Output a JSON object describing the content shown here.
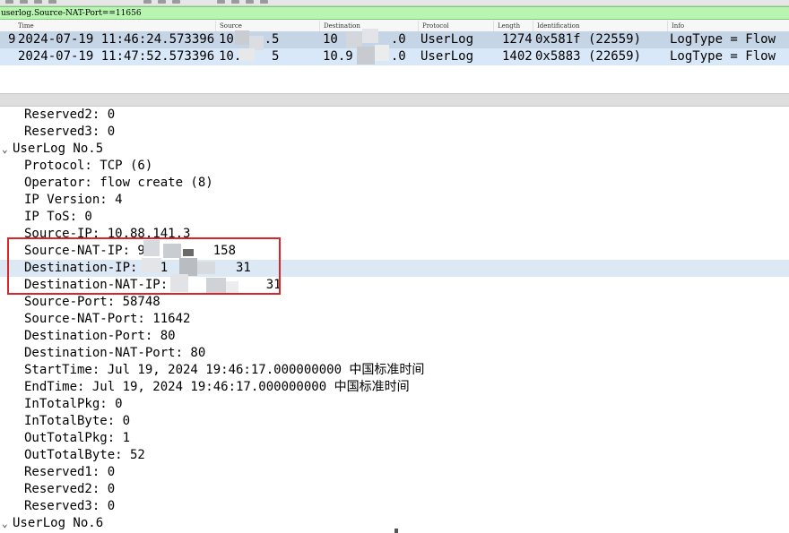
{
  "filter": {
    "value": "userlog.Source-NAT-Port==11656"
  },
  "packet_list": {
    "columns": [
      "Time",
      "Source",
      "Destination",
      "Protocol",
      "Length",
      "Identification",
      "Info"
    ],
    "rows": [
      {
        "no": "9",
        "time": "2024-07-19 11:46:24.573396",
        "source": "10.   .5",
        "destination": "10       .0",
        "protocol": "UserLog",
        "length": "1274",
        "identification": "0x581f (22559)",
        "info": "LogType = Flow"
      },
      {
        "no": "",
        "time": "2024-07-19 11:47:52.573396",
        "source": "10.    5",
        "destination": "10.9     .0",
        "protocol": "UserLog",
        "length": "1402",
        "identification": "0x5883 (22659)",
        "info": "LogType = Flow"
      }
    ]
  },
  "details": {
    "lines": [
      {
        "text": "Reserved2: 0"
      },
      {
        "text": "Reserved3: 0"
      },
      {
        "text": "UserLog No.5"
      },
      {
        "text": "Protocol: TCP (6)"
      },
      {
        "text": "Operator: flow create (8)"
      },
      {
        "text": "IP Version: 4"
      },
      {
        "text": "IP ToS: 0"
      },
      {
        "text": "Source-IP: 10.88.141.3"
      },
      {
        "text": "Source-NAT-IP: 9         158"
      },
      {
        "text": "Destination-IP: 9.1         31"
      },
      {
        "text": "Destination-NAT-IP: 9.          31"
      },
      {
        "text": "Source-Port: 58748"
      },
      {
        "text": "Source-NAT-Port: 11642"
      },
      {
        "text": "Destination-Port: 80"
      },
      {
        "text": "Destination-NAT-Port: 80"
      },
      {
        "text": "StartTime: Jul 19, 2024 19:46:17.000000000 中国标准时间"
      },
      {
        "text": "EndTime: Jul 19, 2024 19:46:17.000000000 中国标准时间"
      },
      {
        "text": "InTotalPkg: 0"
      },
      {
        "text": "InTotalByte: 0"
      },
      {
        "text": "OutTotalPkg: 1"
      },
      {
        "text": "OutTotalByte: 52"
      },
      {
        "text": "Reserved1: 0"
      },
      {
        "text": "Reserved2: 0"
      },
      {
        "text": "Reserved3: 0"
      },
      {
        "text": "UserLog No.6"
      }
    ]
  },
  "icons": {
    "expand": "chevron-down-icon"
  },
  "colors": {
    "filter_bg": "#b8f5b0",
    "selected_row": "#c6d5e6",
    "highlight_box": "#d9262b"
  }
}
